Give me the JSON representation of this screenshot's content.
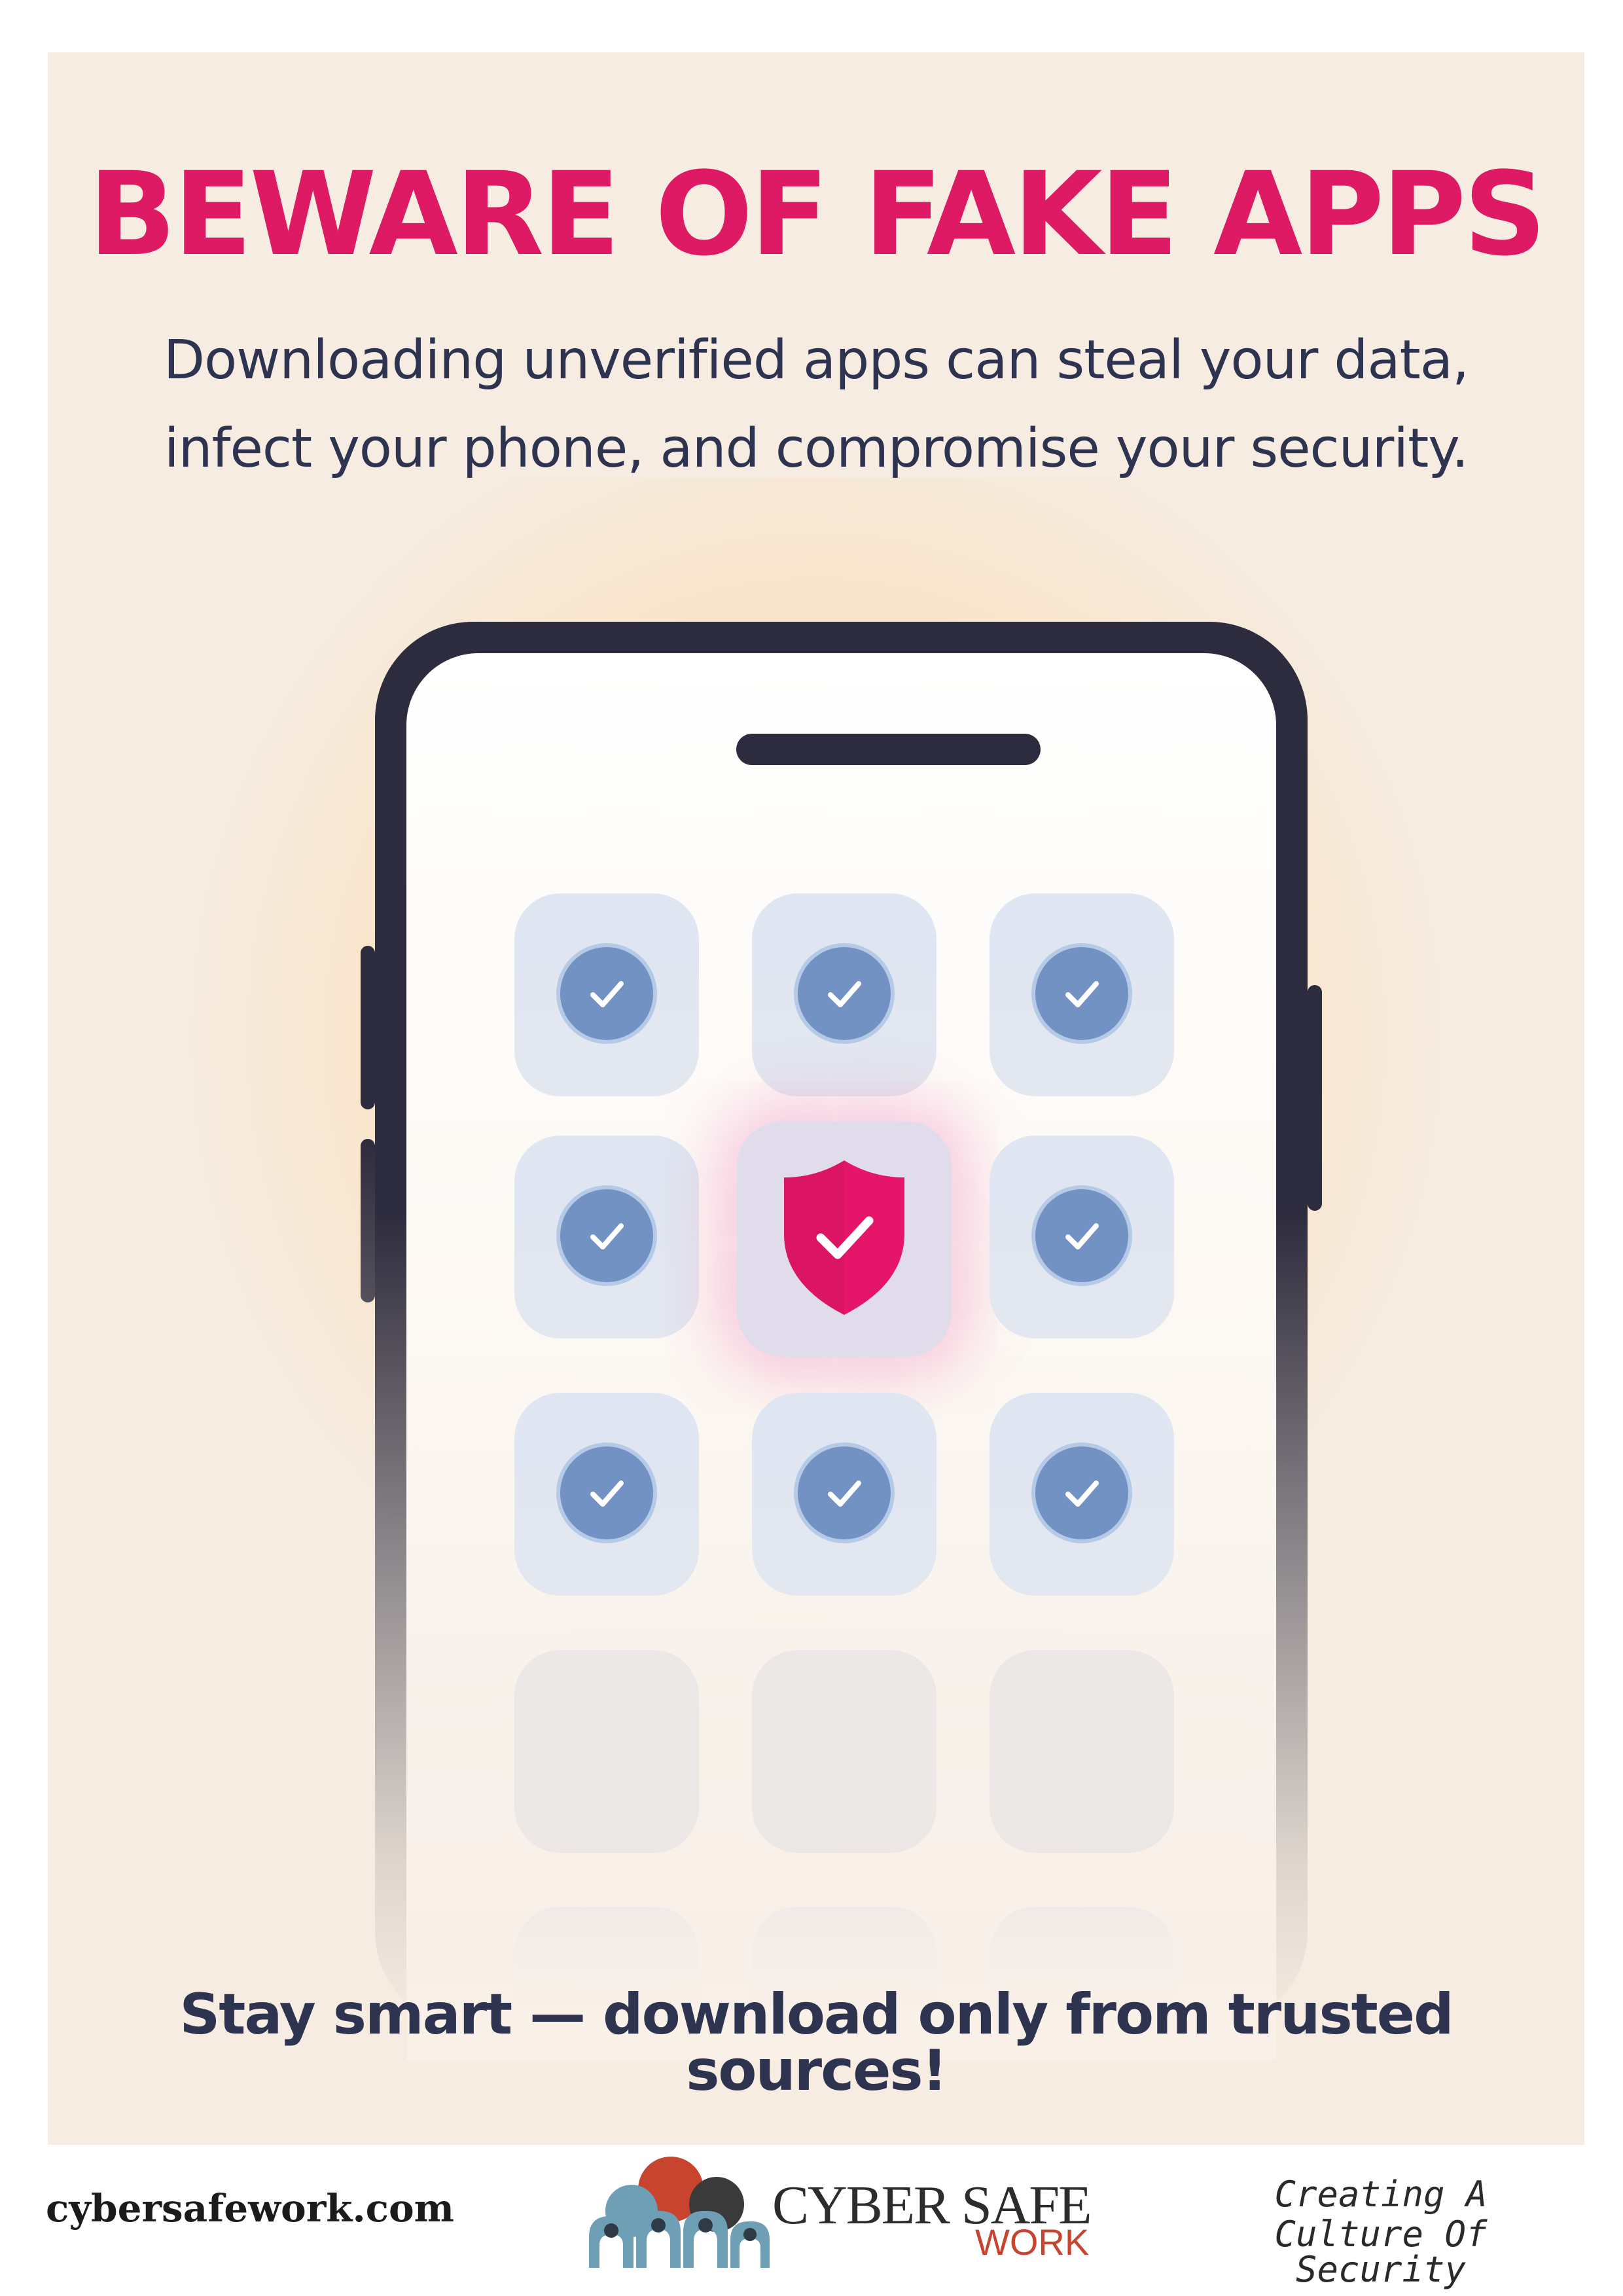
{
  "poster": {
    "title": "BEWARE OF FAKE APPS",
    "subtitle_line1": "Downloading unverified apps can steal your data,",
    "subtitle_line2": "infect your phone, and compromise your security.",
    "call_to_action": "Stay smart — download only from trusted sources!"
  },
  "phone": {
    "app_tiles": [
      {
        "row": 1,
        "col": 1,
        "icon": "check-icon"
      },
      {
        "row": 1,
        "col": 2,
        "icon": "check-icon"
      },
      {
        "row": 1,
        "col": 3,
        "icon": "check-icon"
      },
      {
        "row": 2,
        "col": 1,
        "icon": "check-icon"
      },
      {
        "row": 2,
        "col": 2,
        "icon": "shield-check-icon"
      },
      {
        "row": 2,
        "col": 3,
        "icon": "check-icon"
      },
      {
        "row": 3,
        "col": 1,
        "icon": "check-icon"
      },
      {
        "row": 3,
        "col": 2,
        "icon": "check-icon"
      },
      {
        "row": 3,
        "col": 3,
        "icon": "check-icon"
      }
    ]
  },
  "footer": {
    "website": "cybersafework.com",
    "logo_main": "CYBER SAFE",
    "logo_sub": "WORK",
    "tagline_line1": "Creating A",
    "tagline_line2": "Culture Of Security"
  },
  "colors": {
    "title": "#dd1a63",
    "text": "#2e3350",
    "background": "#f6ece1",
    "phone_frame": "#2d2c3e",
    "check_badge": "#7392c4",
    "shield": "#e5166a"
  }
}
